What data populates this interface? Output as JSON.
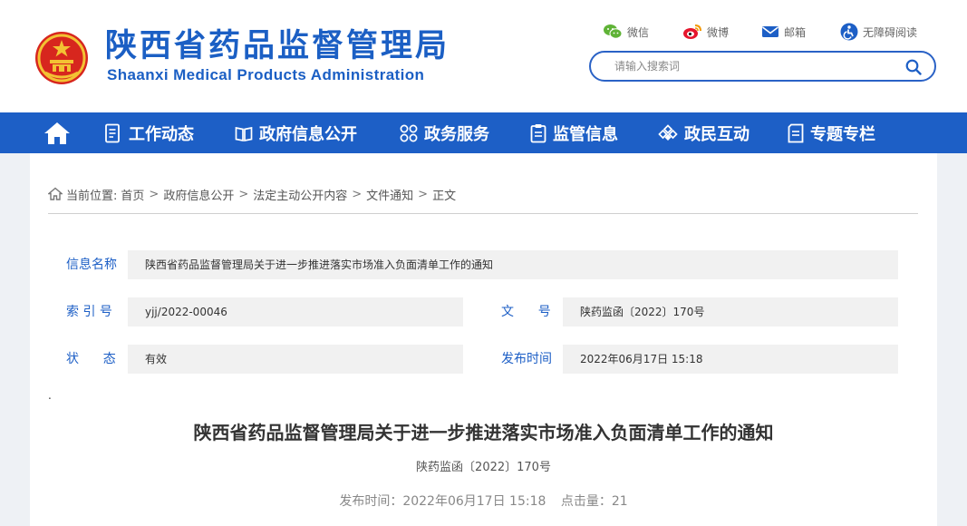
{
  "header": {
    "site_name_cn": "陕西省药品监督管理局",
    "site_name_en": "Shaanxi Medical Products Administration",
    "links": [
      {
        "label": "微信",
        "icon": "wechat-icon"
      },
      {
        "label": "微博",
        "icon": "weibo-icon"
      },
      {
        "label": "邮箱",
        "icon": "mail-icon"
      },
      {
        "label": "无障碍阅读",
        "icon": "accessibility-icon"
      }
    ],
    "search": {
      "placeholder": "请输入搜索词",
      "value": ""
    }
  },
  "nav": {
    "items": [
      {
        "label": "工作动态",
        "icon": "document-list-icon"
      },
      {
        "label": "政府信息公开",
        "icon": "book-icon"
      },
      {
        "label": "政务服务",
        "icon": "grid-icon"
      },
      {
        "label": "监管信息",
        "icon": "clipboard-icon"
      },
      {
        "label": "政民互动",
        "icon": "interaction-icon"
      },
      {
        "label": "专题专栏",
        "icon": "folder-icon"
      }
    ]
  },
  "breadcrumb": {
    "prefix": "当前位置:",
    "items": [
      "首页",
      "政府信息公开",
      "法定主动公开内容",
      "文件通知",
      "正文"
    ],
    "separator": ">"
  },
  "meta": {
    "name_label": "信息名称",
    "name_value": "陕西省药品监督管理局关于进一步推进落实市场准入负面清单工作的通知",
    "index_label": "索 引 号",
    "index_value": "yjj/2022-00046",
    "docno_label": "文      号",
    "docno_value": "陕药监函〔2022〕170号",
    "status_label": "状      态",
    "status_value": "有效",
    "date_label": "发布时间",
    "date_value": "2022年06月17日 15:18"
  },
  "article": {
    "dot": ".",
    "title": "陕西省药品监督管理局关于进一步推进落实市场准入负面清单工作的通知",
    "doc_no": "陕药监函〔2022〕170号",
    "publish": "发布时间：2022年06月17日 15:18",
    "clicks": "点击量：21"
  },
  "colors": {
    "brand_blue": "#1b5fc4",
    "nav_blue": "#1d5fc6",
    "meta_bg": "#f1f1f1",
    "page_bg": "#eef1f5"
  }
}
